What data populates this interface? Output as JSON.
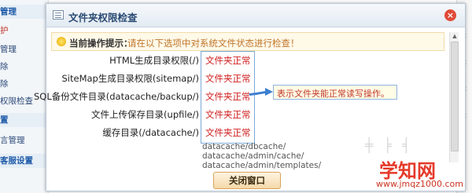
{
  "sidebar": {
    "items": [
      "管理",
      "护",
      "管理",
      "除",
      "除",
      "权限检查",
      "置",
      "言管理",
      "客服设置"
    ]
  },
  "dialog": {
    "title": "文件夹权限检查",
    "close_symbol": "×",
    "notice_label": "当前操作提示：",
    "notice_text": "请在以下选项中对系统文件状态进行检查！",
    "rows": [
      {
        "label": "HTML生成目录权限(/)",
        "status": "文件夹正常"
      },
      {
        "label": "SiteMap生成目录权限(sitemap/)",
        "status": "文件夹正常"
      },
      {
        "label": "SQL备份文件目录(datacache/backup/)",
        "status": "文件夹正常"
      },
      {
        "label": "文件上传保存目录(upfile/)",
        "status": "文件夹正常"
      },
      {
        "label": "缓存目录(/datacache/)",
        "status": "文件夹正常"
      }
    ],
    "hint": "表示文件夹能正常读写操作。",
    "paths": [
      "datacache/dbcache/",
      "datacache/admin/cache/",
      "datacache/admin/templates/"
    ],
    "button_label": "关闭窗口"
  },
  "watermark": {
    "logo": "学知网",
    "url": "www.jmqz1000.com"
  },
  "colors": {
    "status_red": "#d01f1f",
    "notice_orange": "#c0752a",
    "title_blue": "#2b4b74",
    "accent_blue": "#7ca9d6"
  }
}
